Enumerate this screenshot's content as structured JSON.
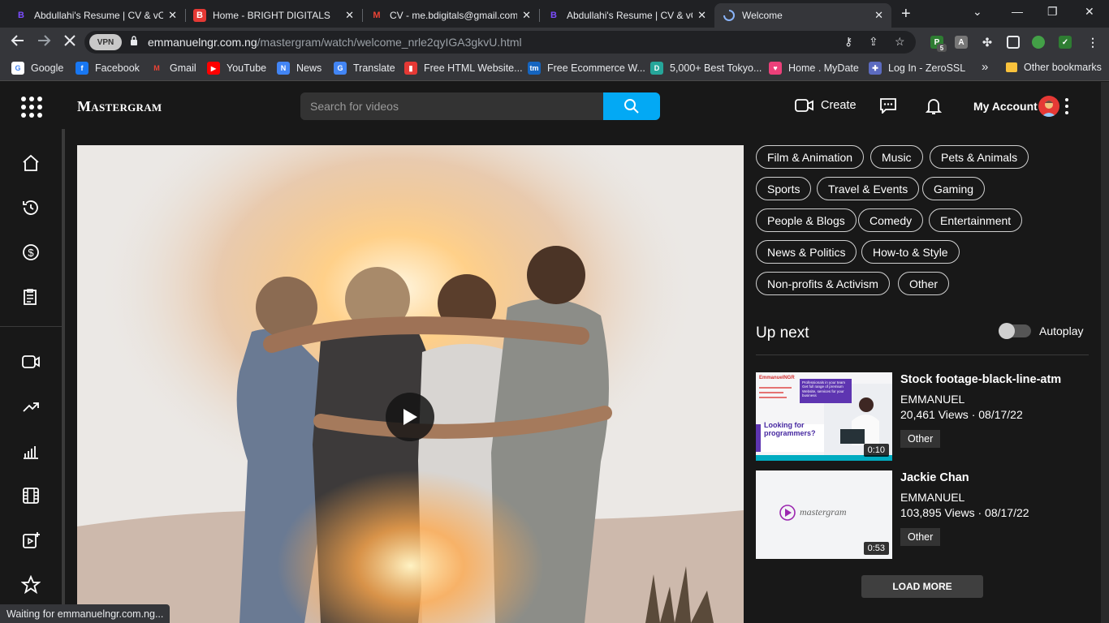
{
  "browser": {
    "tabs": [
      {
        "title": "Abdullahi's Resume | CV & vCard",
        "favicon": "purple-b-icon",
        "active": false
      },
      {
        "title": "Home - BRIGHT DIGITALS",
        "favicon": "red-b-icon",
        "active": false
      },
      {
        "title": "CV - me.bdigitals@gmail.com - Gmail",
        "favicon": "gmail-icon",
        "active": false
      },
      {
        "title": "Abdullahi's Resume | CV & vCard",
        "favicon": "purple-b-icon",
        "active": false
      },
      {
        "title": "Welcome",
        "favicon": "loading-spinner-icon",
        "active": true
      }
    ],
    "url_host": "emmanuelngr.com.ng",
    "url_path": "/mastergram/watch/welcome_nrle2qyIGA3gkvU.html",
    "vpn_label": "VPN",
    "extension_badge": "5",
    "bookmarks": [
      {
        "label": "Google",
        "icon": "google-icon"
      },
      {
        "label": "Facebook",
        "icon": "facebook-icon"
      },
      {
        "label": "Gmail",
        "icon": "gmail-icon"
      },
      {
        "label": "YouTube",
        "icon": "youtube-icon"
      },
      {
        "label": "News",
        "icon": "google-news-icon"
      },
      {
        "label": "Translate",
        "icon": "translate-icon"
      },
      {
        "label": "Free HTML Website...",
        "icon": "html-icon"
      },
      {
        "label": "Free Ecommerce W...",
        "icon": "tm-icon"
      },
      {
        "label": "5,000+ Best Tokyo...",
        "icon": "d-icon"
      },
      {
        "label": "Home . MyDate",
        "icon": "heart-icon"
      },
      {
        "label": "Log In - ZeroSSL",
        "icon": "puzzle-icon"
      }
    ],
    "bookmarks_overflow": "»",
    "other_bookmarks": "Other bookmarks",
    "status_text": "Waiting for emmanuelngr.com.ng..."
  },
  "site": {
    "logo": "Mastergram",
    "search_placeholder": "Search for videos",
    "create_label": "Create",
    "account_label": "My Account"
  },
  "sidebar": {
    "items": [
      "home-icon",
      "history-icon",
      "dollar-icon",
      "clipboard-icon",
      "video-camera-icon",
      "trending-icon",
      "bar-chart-icon",
      "film-icon",
      "add-video-icon",
      "star-icon"
    ]
  },
  "categories": [
    "Film & Animation",
    "Music",
    "Pets & Animals",
    "Sports",
    "Travel & Events",
    "Gaming",
    "People & Blogs",
    "Comedy",
    "Entertainment",
    "News & Politics",
    "How-to & Style",
    "Non-profits & Activism",
    "Other"
  ],
  "up_next": {
    "heading": "Up next",
    "autoplay_label": "Autoplay",
    "autoplay_on": false,
    "videos": [
      {
        "title": "Stock footage-black-line-atm",
        "channel": "EMMANUEL",
        "meta": "20,461 Views · 08/17/22",
        "tag": "Other",
        "duration": "0:10",
        "thumb_text": {
          "brand": "EmmanuelNGR",
          "box": "Professionals in your team",
          "box_sub": "Get full range of premium Website, services for your business",
          "heading": "Looking for programmers?"
        }
      },
      {
        "title": "Jackie Chan",
        "channel": "EMMANUEL",
        "meta": "103,895 Views · 08/17/22",
        "tag": "Other",
        "duration": "0:53",
        "thumb_text": {
          "brand": "mastergram"
        }
      }
    ],
    "load_more": "LOAD MORE"
  },
  "colors": {
    "accent": "#03a9f4",
    "background": "#181818",
    "chrome": "#35363a"
  }
}
